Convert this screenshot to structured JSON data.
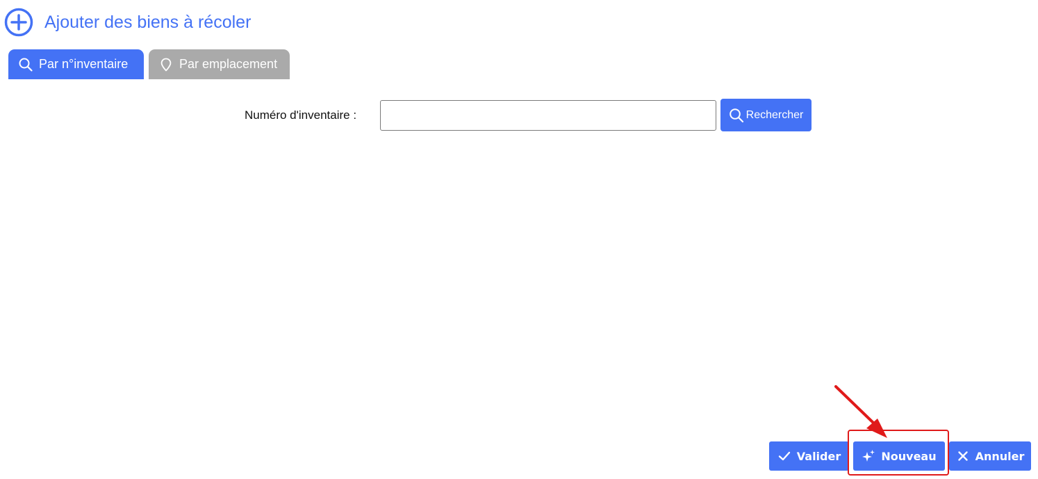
{
  "header": {
    "title": "Ajouter des biens à récoler",
    "icon": "plus-circle-icon"
  },
  "tabs": [
    {
      "label": "Par n°inventaire",
      "icon": "search-icon",
      "active": true
    },
    {
      "label": "Par emplacement",
      "icon": "location-pin-icon",
      "active": false
    }
  ],
  "search": {
    "label": "Numéro d'inventaire  :",
    "value": "",
    "button_label": "Rechercher",
    "button_icon": "search-icon"
  },
  "footer": {
    "valider_label": "Valider",
    "valider_icon": "check-icon",
    "nouveau_label": "Nouveau",
    "nouveau_icon": "sparkle-icon",
    "annuler_label": "Annuler",
    "annuler_icon": "close-icon"
  },
  "colors": {
    "accent": "#4472f5",
    "inactive_tab": "#aaaaaa",
    "annotation": "#e01a1a"
  }
}
